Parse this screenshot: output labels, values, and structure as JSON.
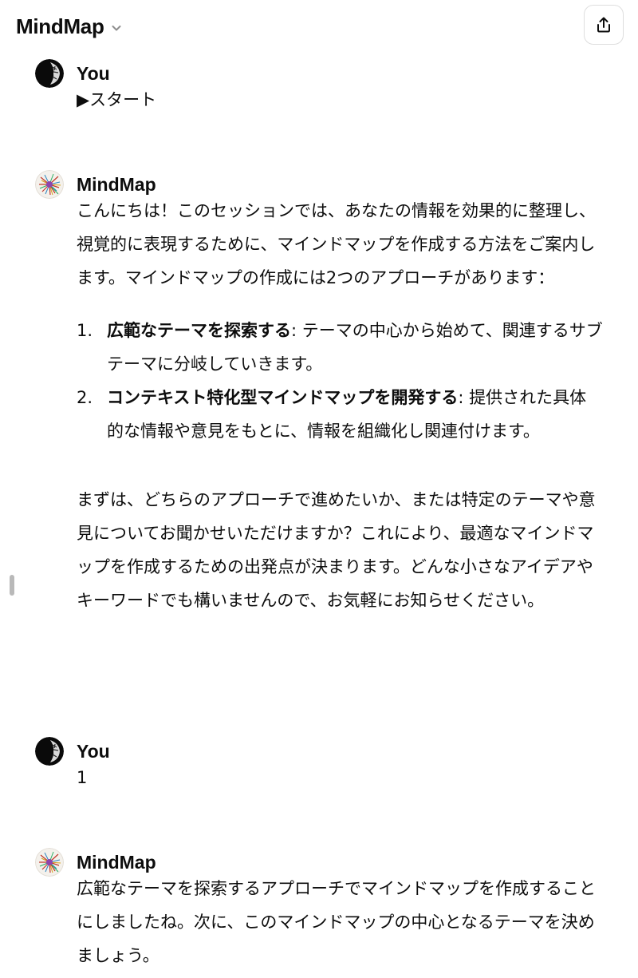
{
  "header": {
    "title": "MindMap",
    "title_icon": "chevron-down-icon",
    "share_icon": "share-icon"
  },
  "messages": [
    {
      "sender": "You",
      "avatar": "user-avatar",
      "text": "▶スタート"
    },
    {
      "sender": "MindMap",
      "avatar": "mindmap-avatar",
      "intro": "こんにちは！このセッションでは、あなたの情報を効果的に整理し、視覚的に表現するために、マインドマップを作成する方法をご案内します。マインドマップの作成には2つのアプローチがあります：",
      "list": [
        {
          "num": "1.",
          "bold": "広範なテーマを探索する",
          "rest": ": テーマの中心から始めて、関連するサブテーマに分岐していきます。"
        },
        {
          "num": "2.",
          "bold": "コンテキスト特化型マインドマップを開発する",
          "rest": ": 提供された具体的な情報や意見をもとに、情報を組織化し関連付けます。"
        }
      ],
      "outro": "まずは、どちらのアプローチで進めたいか、または特定のテーマや意見についてお聞かせいただけますか？これにより、最適なマインドマップを作成するための出発点が決まります。どんな小さなアイデアやキーワードでも構いませんので、お気軽にお知らせください。"
    },
    {
      "sender": "You",
      "avatar": "user-avatar",
      "text": "1"
    },
    {
      "sender": "MindMap",
      "avatar": "mindmap-avatar",
      "text": "広範なテーマを探索するアプローチでマインドマップを作成することにしましたね。次に、このマインドマップの中心となるテーマを決めましょう。"
    }
  ],
  "colors": {
    "text": "#0d0d0d",
    "border": "#dedede",
    "chevron": "#8e8e8e",
    "scroll_handle": "#b9b9b9"
  }
}
